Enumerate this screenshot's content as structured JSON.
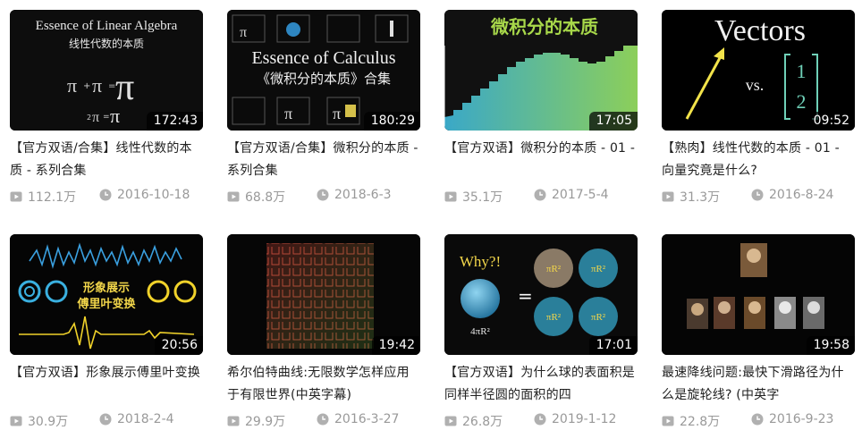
{
  "videos": [
    {
      "title": "【官方双语/合集】线性代数的本质 - 系列合集",
      "duration": "172:43",
      "views": "112.1万",
      "date": "2016-10-18",
      "thumb_text": {
        "line1": "Essence of Linear Algebra",
        "line2": "线性代数的本质"
      }
    },
    {
      "title": "【官方双语/合集】微积分的本质 - 系列合集",
      "duration": "180:29",
      "views": "68.8万",
      "date": "2018-6-3",
      "thumb_text": {
        "line1": "Essence of Calculus",
        "line2": "《微积分的本质》合集"
      }
    },
    {
      "title": "【官方双语】微积分的本质 - 01 -",
      "duration": "17:05",
      "views": "35.1万",
      "date": "2017-5-4",
      "thumb_text": {
        "line1": "微积分的本质"
      }
    },
    {
      "title": "【熟肉】线性代数的本质 - 01 - 向量究竟是什么?",
      "duration": "09:52",
      "views": "31.3万",
      "date": "2016-8-24",
      "thumb_text": {
        "line1": "Vectors",
        "line2": "vs.",
        "line3": "1",
        "line4": "2"
      }
    },
    {
      "title": "【官方双语】形象展示傅里叶变换",
      "duration": "20:56",
      "views": "30.9万",
      "date": "2018-2-4",
      "thumb_text": {
        "line1": "形象展示",
        "line2": "傅里叶变换"
      }
    },
    {
      "title": "希尔伯特曲线:无限数学怎样应用于有限世界(中英字幕)",
      "duration": "19:42",
      "views": "29.9万",
      "date": "2016-3-27",
      "thumb_text": {}
    },
    {
      "title": "【官方双语】为什么球的表面积是同样半径圆的面积的四",
      "duration": "17:01",
      "views": "26.8万",
      "date": "2019-1-12",
      "thumb_text": {
        "line1": "Why?!",
        "line2": "4πR²",
        "line3": "πR²"
      }
    },
    {
      "title": "最速降线问题:最快下滑路径为什么是旋轮线? (中英字",
      "duration": "19:58",
      "views": "22.8万",
      "date": "2016-9-23",
      "thumb_text": {}
    }
  ],
  "icons": {
    "views": "play-icon",
    "date": "clock-icon"
  },
  "colors": {
    "meta": "#999999",
    "title": "#212121",
    "icon": "#b0b0b0"
  }
}
